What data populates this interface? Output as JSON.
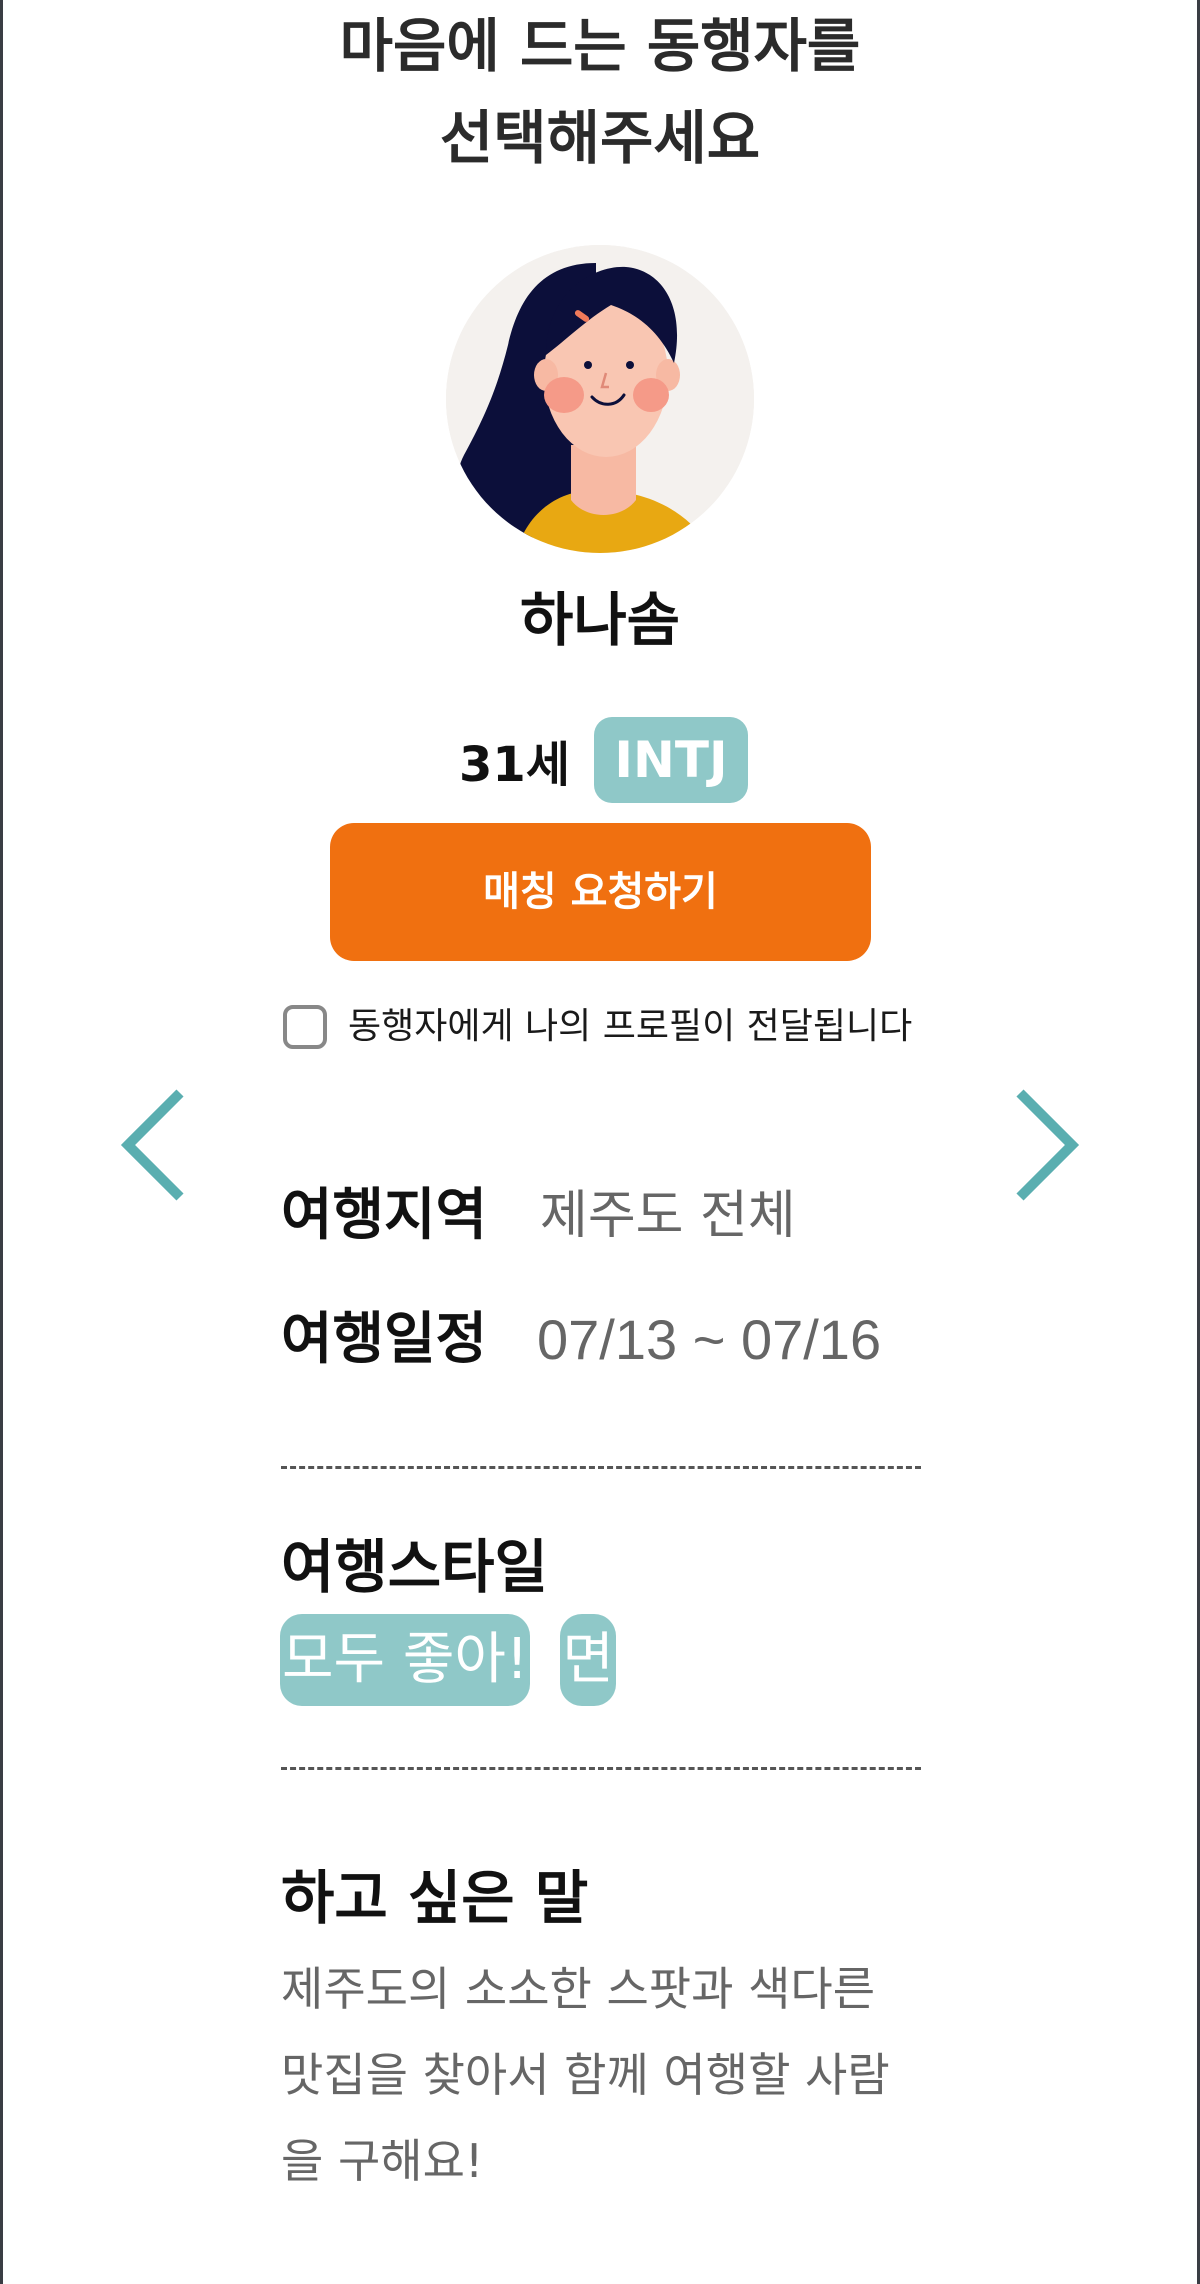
{
  "header": {
    "title_line1": "마음에 드는 동행자를",
    "title_line2": "선택해주세요"
  },
  "profile": {
    "avatar_icon": "woman-avatar-illustration",
    "name": "하나솜",
    "age": "31세",
    "mbti": "INTJ"
  },
  "actions": {
    "match_button_label": "매칭 요청하기",
    "consent_label": "동행자에게 나의 프로필이 전달됩니다",
    "consent_checked": false
  },
  "navigation": {
    "prev_icon": "chevron-left-icon",
    "next_icon": "chevron-right-icon"
  },
  "trip": {
    "region_label": "여행지역",
    "region_value": "제주도 전체",
    "schedule_label": "여행일정",
    "schedule_value": "07/13 ~ 07/16"
  },
  "style": {
    "title": "여행스타일",
    "tags": [
      "모두 좋아!",
      "면"
    ]
  },
  "message": {
    "title": "하고 싶은 말",
    "body": "제주도의 소소한 스팟과 색다른 맛집을 찾아서 함께 여행할 사람을 구해요!"
  },
  "colors": {
    "accent_orange": "#f07010",
    "tag_teal": "#8fc8c8",
    "arrow_teal": "#5aaeb0",
    "text_dark": "#111111",
    "text_gray": "#666666"
  }
}
